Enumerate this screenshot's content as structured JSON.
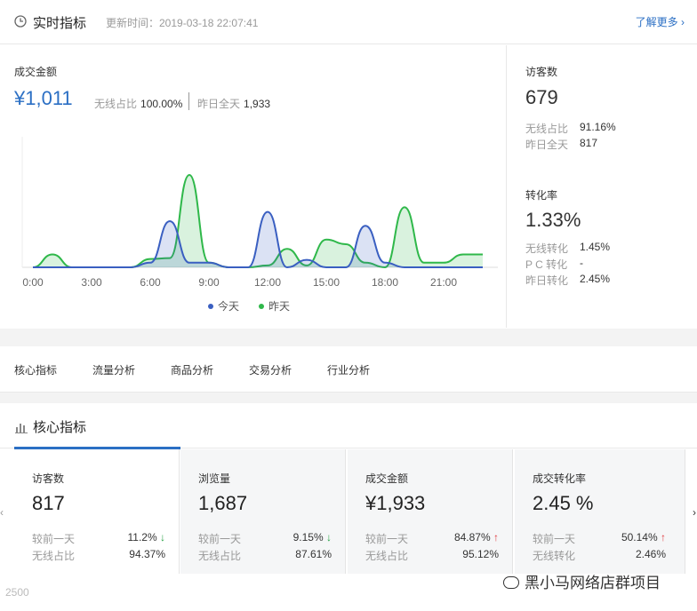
{
  "header": {
    "title": "实时指标",
    "update_time": "更新时间：2019-03-18 22:07:41",
    "more_link": "了解更多 ›"
  },
  "realtime": {
    "gmv": {
      "label": "成交金额",
      "value": "¥1,011",
      "wireless_label": "无线占比",
      "wireless_value": "100.00%",
      "yesterday_label": "昨日全天",
      "yesterday_value": "1,933"
    },
    "visitors": {
      "label": "访客数",
      "value": "679",
      "wireless_label": "无线占比",
      "wireless_value": "91.16%",
      "yesterday_label": "昨日全天",
      "yesterday_value": "817"
    },
    "conversion": {
      "label": "转化率",
      "value": "1.33%",
      "wireless_label": "无线转化",
      "wireless_value": "1.45%",
      "pc_label": "P C 转化",
      "pc_value": "-",
      "yesterday_label": "昨日转化",
      "yesterday_value": "2.45%"
    }
  },
  "chart_data": {
    "type": "area",
    "x": [
      0,
      1,
      2,
      3,
      4,
      5,
      6,
      7,
      8,
      9,
      10,
      11,
      12,
      13,
      14,
      15,
      16,
      17,
      18,
      19,
      20,
      21,
      22,
      23
    ],
    "x_tick_labels": [
      "0:00",
      "3:00",
      "6:00",
      "9:00",
      "12:00",
      "15:00",
      "18:00",
      "21:00"
    ],
    "series": [
      {
        "name": "今天",
        "color": "#3a5fc1",
        "values": [
          0,
          0,
          0,
          0,
          0,
          0,
          0.05,
          0.5,
          0.05,
          0.05,
          0,
          0,
          0.6,
          0,
          0.08,
          0,
          0,
          0.45,
          0.05,
          0,
          0,
          0,
          0,
          0
        ]
      },
      {
        "name": "昨天",
        "color": "#2fb84a",
        "values": [
          0,
          0.14,
          0,
          0,
          0,
          0,
          0.09,
          0.1,
          1.0,
          0.05,
          0,
          0,
          0.02,
          0.2,
          0.02,
          0.3,
          0.25,
          0.05,
          0,
          0.65,
          0.05,
          0.05,
          0.14,
          0.14
        ]
      }
    ],
    "legend": "bottom",
    "grid": false
  },
  "tabs": [
    "核心指标",
    "流量分析",
    "商品分析",
    "交易分析",
    "行业分析"
  ],
  "core": {
    "title": "核心指标",
    "prev_label": "较前一天",
    "wireless_label": "无线占比",
    "cards": [
      {
        "name": "访客数",
        "value": "817",
        "change": "11.2%",
        "dir": "down",
        "arrow": "↓",
        "r2_label": "无线占比",
        "r2_value": "94.37%"
      },
      {
        "name": "浏览量",
        "value": "1,687",
        "change": "9.15%",
        "dir": "down",
        "arrow": "↓",
        "r2_label": "无线占比",
        "r2_value": "87.61%"
      },
      {
        "name": "成交金额",
        "value": "¥1,933",
        "change": "84.87%",
        "dir": "up",
        "arrow": "↑",
        "r2_label": "无线占比",
        "r2_value": "95.12%"
      },
      {
        "name": "成交转化率",
        "value": "2.45 %",
        "change": "50.14%",
        "dir": "up",
        "arrow": "↑",
        "r2_label": "无线转化",
        "r2_value": "2.46%"
      }
    ]
  },
  "footer": {
    "left_text": "2500",
    "watermark": "黑小马网络店群项目"
  }
}
